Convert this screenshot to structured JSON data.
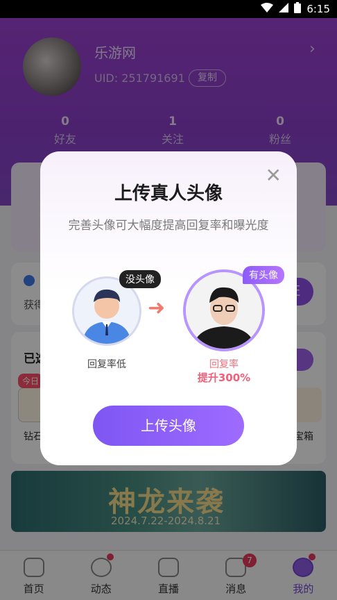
{
  "status_bar": {
    "time": "6:15"
  },
  "profile": {
    "nickname": "乐游网",
    "uid_label": "UID: 251791691",
    "copy_label": "复制",
    "stats": [
      {
        "value": "0",
        "label": "好友"
      },
      {
        "value": "1",
        "label": "关注"
      },
      {
        "value": "0",
        "label": "粉丝"
      }
    ]
  },
  "background": {
    "task_text": "获得",
    "box_title": "已选",
    "today_tag": "今日",
    "item_left": "钻石",
    "item_right": "宝箱",
    "verify_btn": "证"
  },
  "banner": {
    "title": "神龙来袭",
    "dates": "2024.7.22-2024.8.21"
  },
  "tabs": [
    {
      "label": "首页",
      "icon": "heart-home-icon",
      "badge": ""
    },
    {
      "label": "动态",
      "icon": "planet-icon",
      "badge": ""
    },
    {
      "label": "直播",
      "icon": "video-icon",
      "badge": ""
    },
    {
      "label": "消息",
      "icon": "chat-icon",
      "badge": "7"
    },
    {
      "label": "我的",
      "icon": "me-icon",
      "badge": ""
    }
  ],
  "modal": {
    "title": "上传真人头像",
    "subtitle": "完善头像可大幅度提高回复率和曝光度",
    "tag_without": "没头像",
    "tag_with": "有头像",
    "caption_without": "回复率低",
    "caption_with": "回复率",
    "caption_with_boost": "提升300%",
    "upload_button": "上传头像"
  }
}
